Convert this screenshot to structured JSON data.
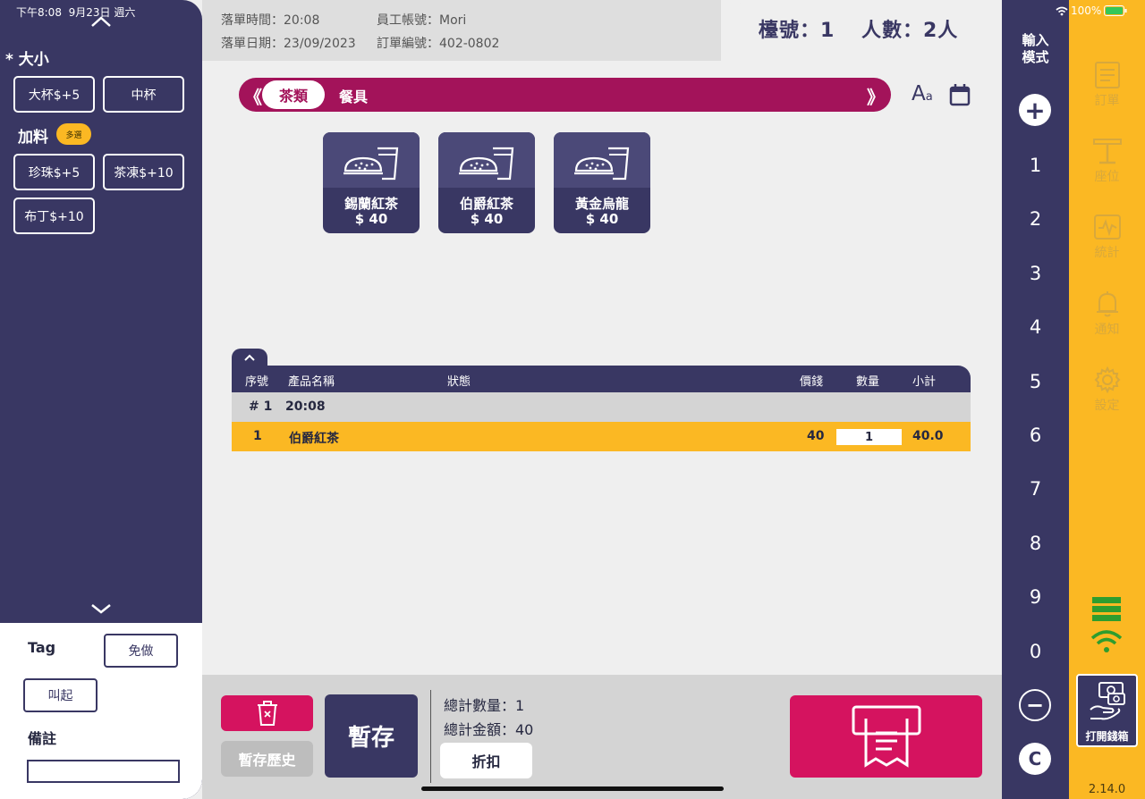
{
  "status_bar": {
    "time": "下午8:08",
    "date": "9月23日 週六",
    "battery": "100%"
  },
  "options": {
    "size_title": "* 大小",
    "size_options": [
      "大杯$+5",
      "中杯"
    ],
    "topping_title": "加料",
    "topping_badge": "多選",
    "topping_options": [
      "珍珠$+5",
      "茶凍$+10",
      "布丁$+10"
    ]
  },
  "left_bottom": {
    "tag_label": "Tag",
    "free_label": "免做",
    "call_label": "叫起",
    "note_label": "備註",
    "note_value": ""
  },
  "header": {
    "order_time": "落單時間：20:08",
    "staff": "員工帳號：Mori",
    "order_date": "落單日期：23/09/2023",
    "order_no": "訂單編號：402-0802",
    "table_no": "檯號：1",
    "guests": "人數：2人"
  },
  "categories": {
    "prev": "《",
    "next": "》",
    "active": "茶類",
    "other": "餐具"
  },
  "toolbar": {
    "font_big": "A",
    "font_small": "a"
  },
  "products": [
    {
      "name": "錫蘭紅茶",
      "price": "$ 40"
    },
    {
      "name": "伯爵紅茶",
      "price": "$ 40"
    },
    {
      "name": "黃金烏龍",
      "price": "$ 40"
    }
  ],
  "order_table": {
    "headers": {
      "seq": "序號",
      "name": "產品名稱",
      "status": "狀態",
      "price": "價錢",
      "qty": "數量",
      "subtotal": "小計"
    },
    "group": {
      "no": "# 1",
      "time": "20:08"
    },
    "rows": [
      {
        "seq": "1",
        "name": "伯爵紅茶",
        "status": "",
        "price": "40",
        "qty": "1",
        "subtotal": "40.0"
      }
    ]
  },
  "bottom": {
    "history_label": "暫存歷史",
    "hold_label": "暫存",
    "total_qty": "總計數量：1",
    "total_amount": "總計金額：40",
    "discount_label": "折扣"
  },
  "keypad": {
    "mode_line1": "輸入",
    "mode_line2": "模式",
    "plus": "+",
    "digits": [
      "1",
      "2",
      "3",
      "4",
      "5",
      "6",
      "7",
      "8",
      "9",
      "0"
    ],
    "minus": "−",
    "clear": "C"
  },
  "menu": {
    "order": "訂單",
    "seat": "座位",
    "stats": "統計",
    "notify": "通知",
    "settings": "設定",
    "cashbox": "打開錢箱",
    "version": "2.14.0"
  },
  "icons": {
    "chevron_up": "chevron-up-icon",
    "chevron_down": "chevron-down-icon",
    "font_size": "font-size-icon",
    "calendar": "calendar-icon",
    "trash": "trash-icon",
    "receipt": "receipt-icon",
    "server": "server-icon",
    "wifi": "wifi-icon",
    "cash": "cash-hand-icon"
  },
  "colors": {
    "primary": "#393763",
    "accent": "#a3135a",
    "danger": "#d5135f",
    "highlight": "#fbb823"
  }
}
